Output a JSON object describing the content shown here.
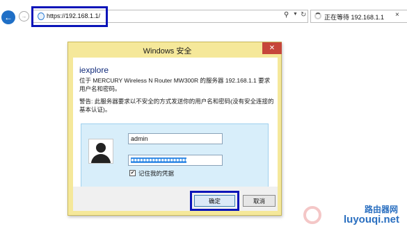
{
  "browser": {
    "url": "https://192.168.1.1/",
    "tab_label": "正在等待 192.168.1.1",
    "icons": [
      "back-arrow-icon",
      "forward-arrow-icon",
      "page-icon",
      "search-icon",
      "dropdown-icon",
      "refresh-icon",
      "tab-spinner-icon",
      "close-icon"
    ]
  },
  "dialog": {
    "title": "Windows 安全",
    "close_glyph": "✕",
    "app_name": "iexplore",
    "message": "位于 MERCURY Wireless N Router MW300R 的服务器 192.168.1.1 要求用户名和密码。",
    "warning": "警告: 此服务器要求以不安全的方式发送你的用户名和密码(没有安全连接的基本认证)。",
    "username_value": "admin",
    "password_mask": "●●●●●●●●●●●●●●●●●●●",
    "remember_checked": true,
    "remember_check_glyph": "✔",
    "remember_label": "记住我的凭据",
    "ok_label": "确定",
    "cancel_label": "取消"
  },
  "watermark": {
    "line1": "路由器网",
    "line2": "luyouqi.net"
  },
  "colors": {
    "highlight_box": "#0a14b8",
    "dialog_frame": "#f5e89a",
    "close_button": "#c6463a",
    "credential_panel": "#d8eefa",
    "password_selection": "#3a8ee6",
    "watermark_blue": "#2a6fc0"
  }
}
